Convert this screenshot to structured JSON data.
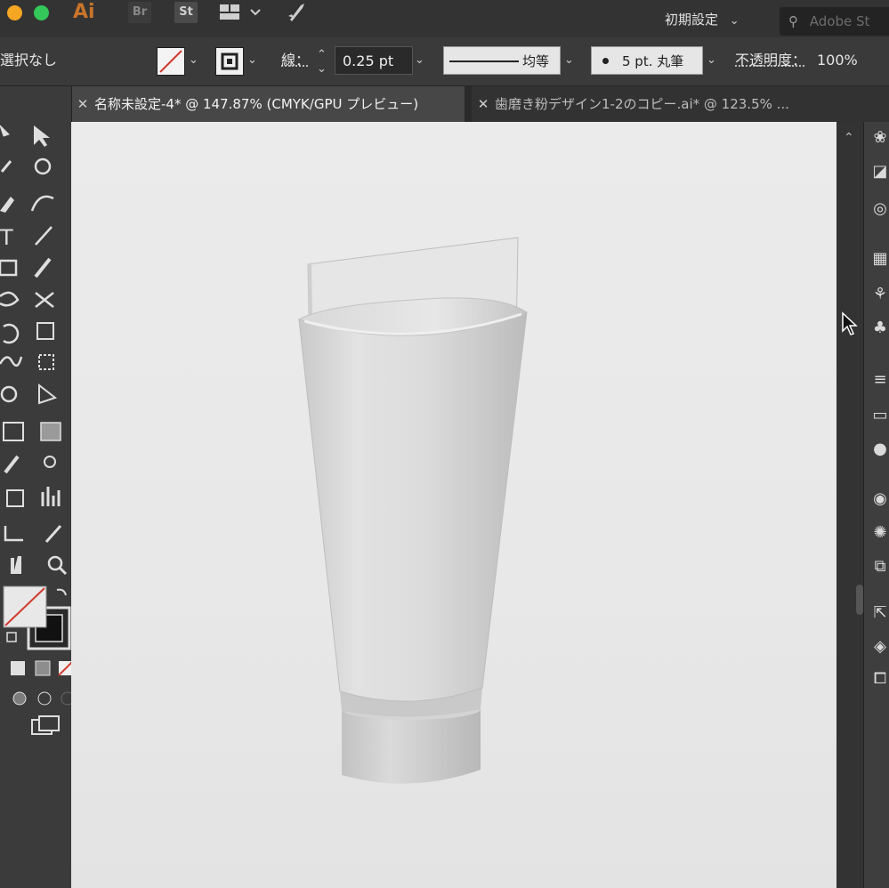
{
  "app": {
    "logo": "Ai",
    "bridge_label": "Br",
    "stock_label": "St",
    "workspace_label": "初期設定",
    "search_placeholder": "Adobe St"
  },
  "control_bar": {
    "selection_label": "選択なし",
    "stroke_label": "線：",
    "stroke_weight": "0.25 pt",
    "profile_label": "均等",
    "brush_label": "5 pt. 丸筆",
    "opacity_label": "不透明度：",
    "opacity_value": "100%"
  },
  "tabs": [
    {
      "label": "名称未設定-4* @ 147.87% (CMYK/GPU プレビュー)",
      "active": true
    },
    {
      "label": "歯磨き粉デザイン1-2のコピー.ai* @ 123.5% ...",
      "active": false
    }
  ],
  "tools": [
    "selection-tool",
    "direct-selection-tool",
    "magic-wand-tool",
    "lasso-tool",
    "pen-tool",
    "curvature-tool",
    "type-tool",
    "line-tool",
    "rectangle-tool",
    "paintbrush-tool",
    "shaper-tool",
    "scissors-tool",
    "rotate-tool",
    "scale-tool",
    "warp-tool",
    "free-transform-tool",
    "shape-builder-tool",
    "perspective-grid-tool",
    "mesh-tool",
    "gradient-tool",
    "eyedropper-tool",
    "blend-tool",
    "symbol-sprayer-tool",
    "column-graph-tool",
    "artboard-tool",
    "slice-tool",
    "hand-tool",
    "zoom-tool"
  ],
  "colors": {
    "ui_dark": "#333333",
    "ui_mid": "#3b3b3b",
    "artboard": "#e9e9e9",
    "none_slash": "#d23b2f",
    "ai_orange": "#c8742a"
  }
}
